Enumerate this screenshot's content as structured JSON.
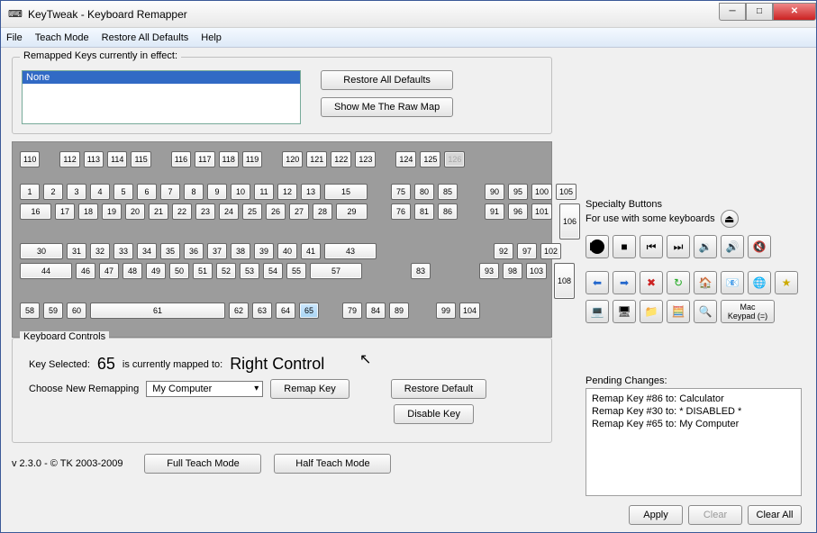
{
  "window": {
    "title": "KeyTweak -   Keyboard Remapper"
  },
  "menu": {
    "file": "File",
    "teach": "Teach Mode",
    "restore": "Restore All Defaults",
    "help": "Help"
  },
  "remapped": {
    "label": "Remapped Keys currently in effect:",
    "none": "None",
    "restore_btn": "Restore All Defaults",
    "rawmap_btn": "Show Me The Raw Map"
  },
  "keyboard_rows": {
    "r0": [
      "110",
      "",
      "112",
      "113",
      "114",
      "115",
      "",
      "116",
      "117",
      "118",
      "119",
      "",
      "120",
      "121",
      "122",
      "123",
      "",
      "124",
      "125",
      "126"
    ],
    "r1": [
      "1",
      "2",
      "3",
      "4",
      "5",
      "6",
      "7",
      "8",
      "9",
      "10",
      "11",
      "12",
      "13",
      "15"
    ],
    "r2": [
      "16",
      "17",
      "18",
      "19",
      "20",
      "21",
      "22",
      "23",
      "24",
      "25",
      "26",
      "27",
      "28",
      "29"
    ],
    "r3": [
      "30",
      "31",
      "32",
      "33",
      "34",
      "35",
      "36",
      "37",
      "38",
      "39",
      "40",
      "41",
      "43"
    ],
    "r4": [
      "44",
      "46",
      "47",
      "48",
      "49",
      "50",
      "51",
      "52",
      "53",
      "54",
      "55",
      "57"
    ],
    "r5": [
      "58",
      "59",
      "60",
      "61",
      "62",
      "63",
      "64",
      "65"
    ],
    "nav1": [
      "75",
      "80",
      "85"
    ],
    "nav2": [
      "76",
      "81",
      "86"
    ],
    "nav3": [
      "83"
    ],
    "nav4": [
      "79",
      "84",
      "89"
    ],
    "num_top": [
      "90",
      "95",
      "100",
      "105"
    ],
    "num1": [
      "91",
      "96",
      "101"
    ],
    "num2": [
      "92",
      "97",
      "102"
    ],
    "num3": [
      "93",
      "98",
      "103"
    ],
    "num4": [
      "99",
      "104"
    ],
    "num_side": [
      "106",
      "108"
    ]
  },
  "selected_key": "65",
  "specialty": {
    "title": "Specialty Buttons",
    "subtitle": "For use with some keyboards",
    "mac_keypad": "Mac\nKeypad (=)"
  },
  "controls": {
    "label": "Keyboard Controls",
    "key_selected_lbl": "Key Selected:",
    "key_selected_val": "65",
    "mapped_lbl": "is currently mapped to:",
    "mapped_val": "Right Control",
    "choose_lbl": "Choose New Remapping",
    "dropdown_val": "My Computer",
    "remap_btn": "Remap Key",
    "restore_btn": "Restore Default",
    "disable_btn": "Disable Key"
  },
  "pending": {
    "label": "Pending Changes:",
    "items": [
      "Remap Key #86 to: Calculator",
      "Remap Key #30 to: * DISABLED *",
      "Remap Key #65 to: My Computer"
    ],
    "apply": "Apply",
    "clear": "Clear",
    "clear_all": "Clear All"
  },
  "footer": {
    "version": "v 2.3.0 - © TK 2003-2009",
    "full": "Full Teach Mode",
    "half": "Half Teach Mode"
  }
}
